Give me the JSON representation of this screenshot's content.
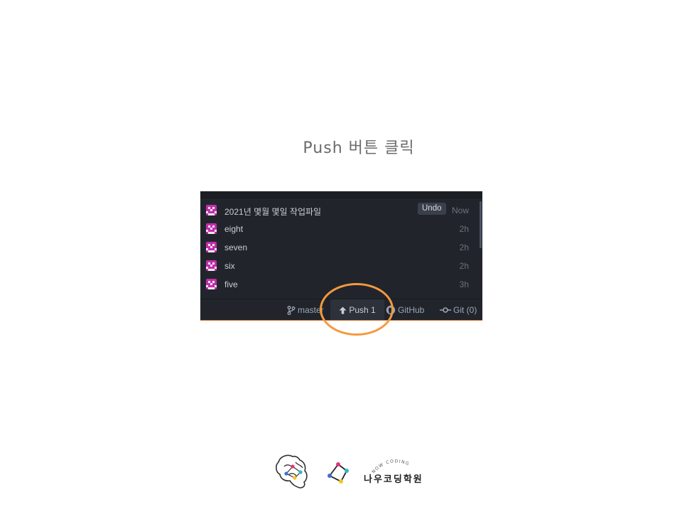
{
  "caption": "Push  버튼 클릭",
  "commits": [
    {
      "message": "2021년 몇월 몇일 작업파일",
      "time": "Now",
      "action": "Undo"
    },
    {
      "message": "eight",
      "time": "2h"
    },
    {
      "message": "seven",
      "time": "2h"
    },
    {
      "message": "six",
      "time": "2h"
    },
    {
      "message": "five",
      "time": "3h"
    }
  ],
  "status_bar": {
    "branch": "master",
    "push": "Push 1",
    "github": "GitHub",
    "git": "Git (0)"
  },
  "brand": {
    "name": "나우코딩학원",
    "arc_text": "NOW CODING"
  },
  "colors": {
    "panel_bg": "#21252b",
    "avatar": "#c12eaa",
    "highlight": "#f5993e"
  },
  "icons": {
    "branch": "git-branch-icon",
    "push": "arrow-up-icon",
    "github": "github-icon",
    "git": "git-commit-icon"
  }
}
